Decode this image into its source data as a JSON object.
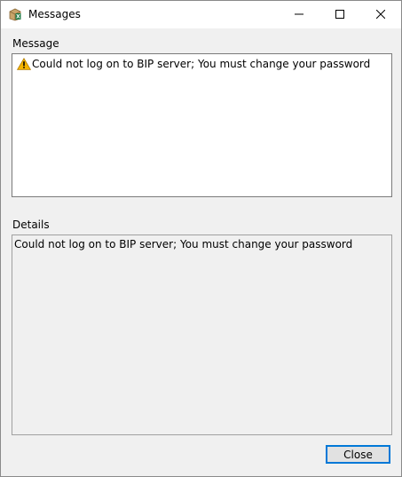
{
  "window": {
    "title": "Messages",
    "app_icon": "excel-box-icon",
    "controls": {
      "minimize_icon": "minimize-icon",
      "maximize_icon": "maximize-icon",
      "close_icon": "close-icon"
    }
  },
  "message_section": {
    "label": "Message",
    "icon": "warning-icon",
    "text": "Could not log on to BIP server; You must change your password"
  },
  "details_section": {
    "label": "Details",
    "text": "Could not log on to BIP server; You must change your password"
  },
  "buttons": {
    "close_label": "Close"
  },
  "colors": {
    "accent": "#0078d7",
    "warning": "#f5b400"
  }
}
